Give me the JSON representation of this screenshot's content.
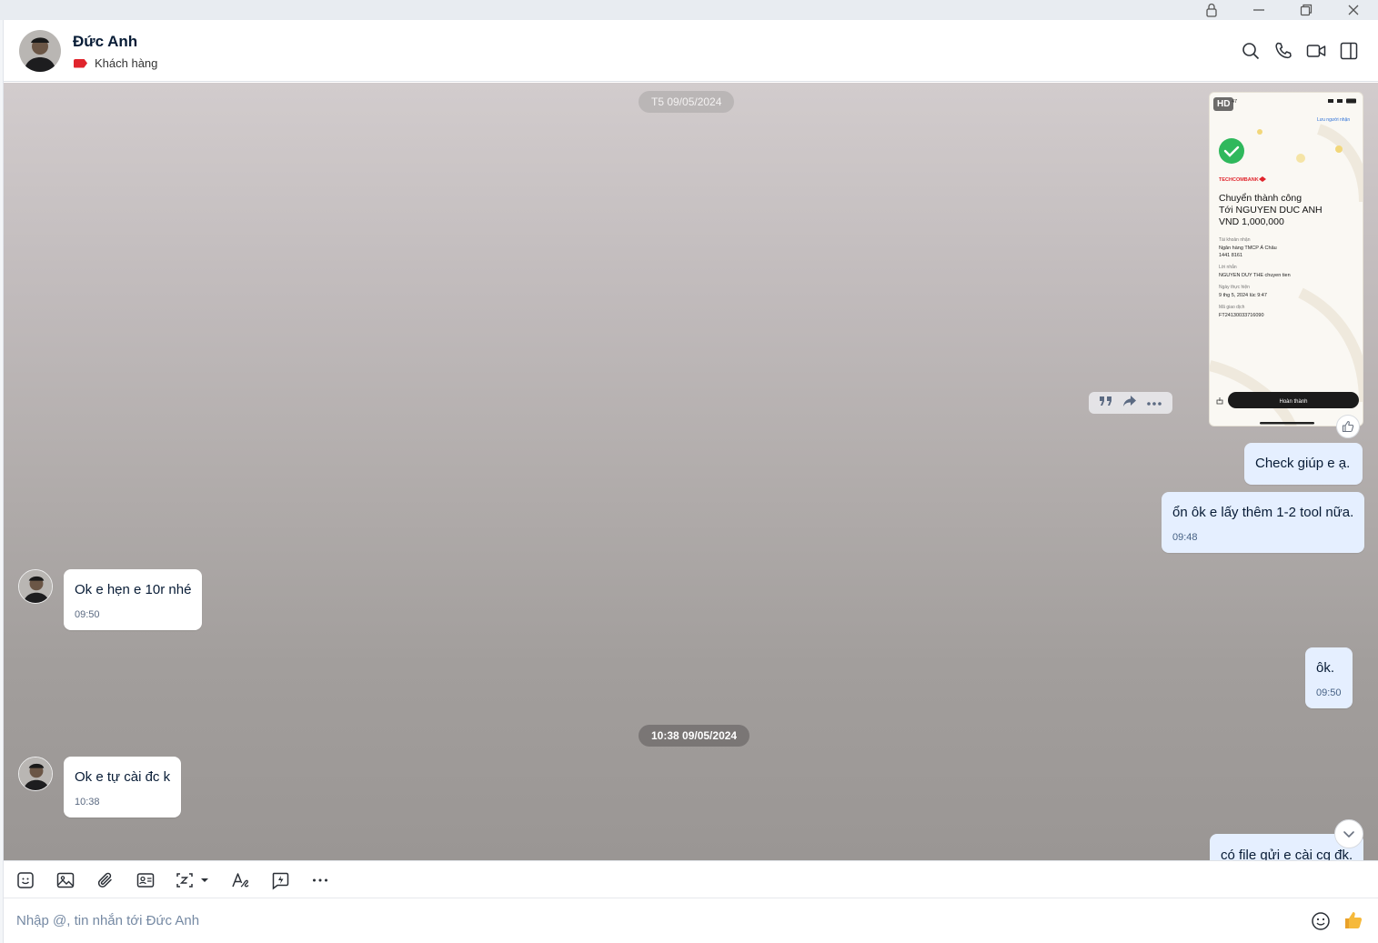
{
  "window": {
    "controls": [
      "lock-icon",
      "minimize-icon",
      "restore-icon",
      "close-icon"
    ]
  },
  "header": {
    "contact_name": "Đức Anh",
    "tag_label": "Khách hàng",
    "tag_color": "#e0242c",
    "actions": [
      "search-icon",
      "phone-icon",
      "video-icon",
      "panel-toggle-icon"
    ]
  },
  "chat": {
    "date_separators": [
      "T5 09/05/2024",
      "10:38 09/05/2024"
    ],
    "image_message": {
      "badge": "HD",
      "status_time": "47",
      "save_recipient": "Lưu người nhận",
      "bank": "TECHCOMBANK",
      "title_line1": "Chuyển thành công",
      "title_line2": "Tới NGUYEN DUC ANH",
      "amount": "VND 1,000,000",
      "account_label": "Tài khoản nhận",
      "account_bank": "Ngân hàng TMCP Á Châu",
      "account_number": "1441 8161",
      "message_label": "Lời nhắn",
      "message_value": "NGUYEN DUY THE chuyen tien",
      "date_label": "Ngày thực hiện",
      "date_value": "9 thg 5, 2024 lúc 9:47",
      "txn_label": "Mã giao dịch",
      "txn_value": "FT24130033716090",
      "done_button": "Hoàn thành"
    },
    "messages": [
      {
        "side": "me",
        "text": "Check giúp e ạ.",
        "time": ""
      },
      {
        "side": "me",
        "text": "ổn ôk e lấy thêm 1-2 tool nữa.",
        "time": "09:48"
      },
      {
        "side": "them",
        "text": "Ok e hẹn e 10r nhé",
        "time": "09:50"
      },
      {
        "side": "me",
        "text": "ôk.",
        "time": "09:50"
      },
      {
        "side": "them",
        "text": "Ok e tự cài đc k",
        "time": "10:38"
      },
      {
        "side": "me",
        "text": "có file gửi e cài cg đk.",
        "time": ""
      }
    ]
  },
  "composer": {
    "placeholder": "Nhập @, tin nhắn tới Đức Anh",
    "tools": [
      "sticker-icon",
      "image-icon",
      "attach-icon",
      "contact-card-icon",
      "screenshot-icon",
      "text-format-icon",
      "quick-message-icon",
      "more-icon"
    ]
  }
}
